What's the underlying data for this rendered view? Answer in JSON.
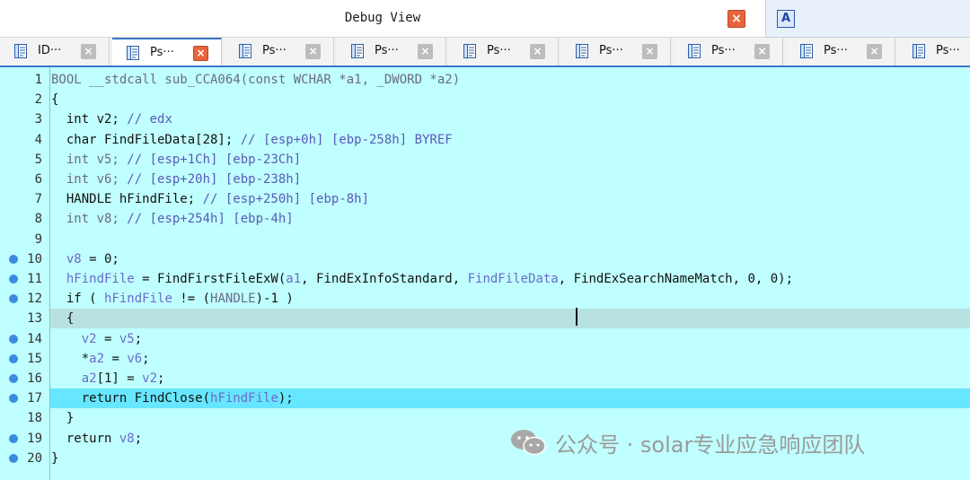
{
  "window": {
    "title": "Debug View",
    "second_icon_label": "A"
  },
  "tabs": [
    {
      "label": "ID···",
      "active": false
    },
    {
      "label": "Ps···",
      "active": true
    },
    {
      "label": "Ps···",
      "active": false
    },
    {
      "label": "Ps···",
      "active": false
    },
    {
      "label": "Ps···",
      "active": false
    },
    {
      "label": "Ps···",
      "active": false
    },
    {
      "label": "Ps···",
      "active": false
    },
    {
      "label": "Ps···",
      "active": false
    },
    {
      "label": "Ps···",
      "active": false
    }
  ],
  "code": {
    "lines": [
      {
        "no": "1",
        "bp": false,
        "hl": "",
        "segs": [
          [
            "g",
            "BOOL __stdcall sub_CCA064(const WCHAR *a1, _DWORD *a2)"
          ]
        ]
      },
      {
        "no": "2",
        "bp": false,
        "hl": "",
        "segs": [
          [
            "k",
            "{"
          ]
        ]
      },
      {
        "no": "3",
        "bp": false,
        "hl": "",
        "segs": [
          [
            "k",
            "  int v2; "
          ],
          [
            "c",
            "// edx"
          ]
        ]
      },
      {
        "no": "4",
        "bp": false,
        "hl": "",
        "segs": [
          [
            "k",
            "  char FindFileData[28]; "
          ],
          [
            "c",
            "// [esp+0h] [ebp-258h] BYREF"
          ]
        ]
      },
      {
        "no": "5",
        "bp": false,
        "hl": "",
        "segs": [
          [
            "g",
            "  int v5; "
          ],
          [
            "c",
            "// [esp+1Ch] [ebp-23Ch]"
          ]
        ]
      },
      {
        "no": "6",
        "bp": false,
        "hl": "",
        "segs": [
          [
            "g",
            "  int v6; "
          ],
          [
            "c",
            "// [esp+20h] [ebp-238h]"
          ]
        ]
      },
      {
        "no": "7",
        "bp": false,
        "hl": "",
        "segs": [
          [
            "k",
            "  HANDLE hFindFile; "
          ],
          [
            "c",
            "// [esp+250h] [ebp-8h]"
          ]
        ]
      },
      {
        "no": "8",
        "bp": false,
        "hl": "",
        "segs": [
          [
            "g",
            "  int v8; "
          ],
          [
            "c",
            "// [esp+254h] [ebp-4h]"
          ]
        ]
      },
      {
        "no": "9",
        "bp": false,
        "hl": "",
        "segs": [
          [
            "k",
            ""
          ]
        ]
      },
      {
        "no": "10",
        "bp": true,
        "hl": "",
        "segs": [
          [
            "v",
            "  v8"
          ],
          [
            "k",
            " = 0;"
          ]
        ]
      },
      {
        "no": "11",
        "bp": true,
        "hl": "",
        "segs": [
          [
            "v",
            "  hFindFile"
          ],
          [
            "k",
            " = FindFirstFileExW("
          ],
          [
            "v",
            "a1"
          ],
          [
            "k",
            ", FindExInfoStandard, "
          ],
          [
            "v",
            "FindFileData"
          ],
          [
            "k",
            ", FindExSearchNameMatch, 0, 0);"
          ]
        ]
      },
      {
        "no": "12",
        "bp": true,
        "hl": "",
        "segs": [
          [
            "k",
            "  if ( "
          ],
          [
            "v",
            "hFindFile"
          ],
          [
            "k",
            " != ("
          ],
          [
            "g",
            "HANDLE"
          ],
          [
            "k",
            ")-1 )"
          ]
        ]
      },
      {
        "no": "13",
        "bp": false,
        "hl": "selected",
        "segs": [
          [
            "k",
            "  {"
          ]
        ]
      },
      {
        "no": "14",
        "bp": true,
        "hl": "",
        "segs": [
          [
            "v",
            "    v2"
          ],
          [
            "k",
            " = "
          ],
          [
            "v",
            "v5"
          ],
          [
            "k",
            ";"
          ]
        ]
      },
      {
        "no": "15",
        "bp": true,
        "hl": "",
        "segs": [
          [
            "k",
            "    *"
          ],
          [
            "v",
            "a2"
          ],
          [
            "k",
            " = "
          ],
          [
            "v",
            "v6"
          ],
          [
            "k",
            ";"
          ]
        ]
      },
      {
        "no": "16",
        "bp": true,
        "hl": "",
        "segs": [
          [
            "v",
            "    a2"
          ],
          [
            "k",
            "[1] = "
          ],
          [
            "v",
            "v2"
          ],
          [
            "k",
            ";"
          ]
        ]
      },
      {
        "no": "17",
        "bp": true,
        "hl": "current",
        "segs": [
          [
            "k",
            "    return FindClose("
          ],
          [
            "v",
            "hFindFile"
          ],
          [
            "k",
            ");"
          ]
        ]
      },
      {
        "no": "18",
        "bp": false,
        "hl": "",
        "segs": [
          [
            "k",
            "  }"
          ]
        ]
      },
      {
        "no": "19",
        "bp": true,
        "hl": "",
        "segs": [
          [
            "k",
            "  return "
          ],
          [
            "v",
            "v8"
          ],
          [
            "k",
            ";"
          ]
        ]
      },
      {
        "no": "20",
        "bp": true,
        "hl": "",
        "segs": [
          [
            "k",
            "}"
          ]
        ]
      }
    ]
  },
  "watermark": {
    "text": "公众号 · solar专业应急响应团队",
    "icon": "wechat-icon"
  },
  "colors": {
    "code_bg": "#c0ffff",
    "current_line": "#66e6ff",
    "selected_line": "#b8e2e2",
    "breakpoint": "#3c8be0",
    "close_active": "#e8643c"
  }
}
